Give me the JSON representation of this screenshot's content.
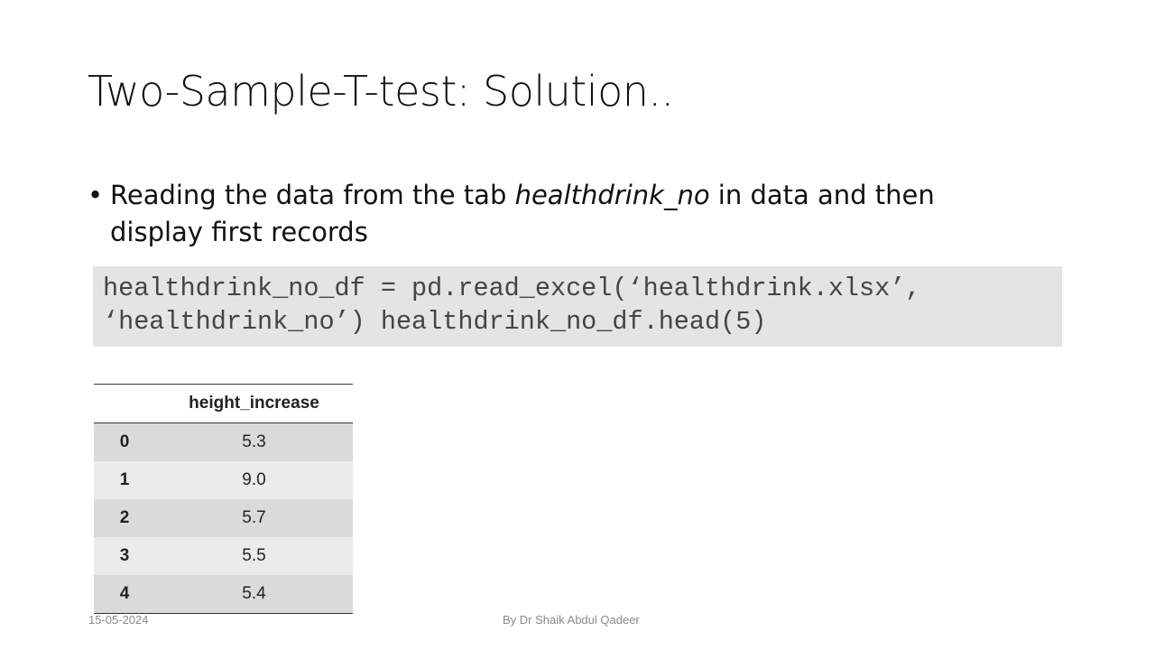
{
  "slide": {
    "title": "Two-Sample-T-test: Solution.."
  },
  "bullet": {
    "symbol": "•",
    "text_before": "Reading the data from the tab ",
    "text_italic": "healthdrink_no",
    "text_after": " in data and then display first records"
  },
  "code": {
    "line1": "healthdrink_no_df = pd.read_excel(‘healthdrink.xlsx’,",
    "line2": "‘healthdrink_no’) healthdrink_no_df.head(5)"
  },
  "table": {
    "header_index": "",
    "header_column": "height_increase",
    "rows": [
      {
        "index": "0",
        "value": "5.3"
      },
      {
        "index": "1",
        "value": "9.0"
      },
      {
        "index": "2",
        "value": "5.7"
      },
      {
        "index": "3",
        "value": "5.5"
      },
      {
        "index": "4",
        "value": "5.4"
      }
    ]
  },
  "footer": {
    "date": "15-05-2024",
    "author": "By Dr Shaik Abdul Qadeer"
  }
}
